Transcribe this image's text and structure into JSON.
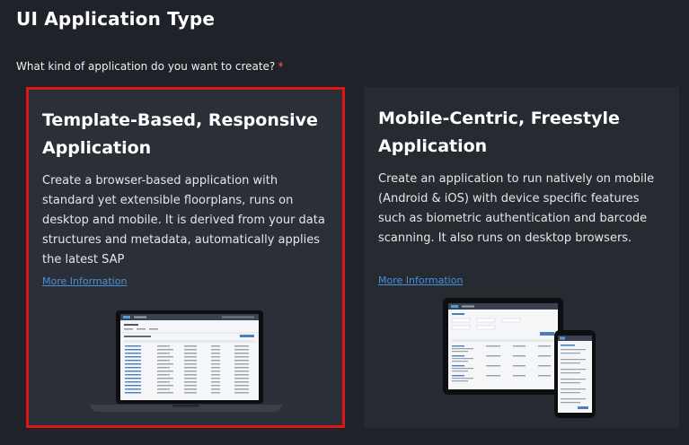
{
  "page": {
    "title": "UI Application Type",
    "question": "What kind of application do you want to create?",
    "required_marker": "*"
  },
  "cards": [
    {
      "title_line1": "Template-Based, Responsive",
      "title_line2": "Application",
      "description": "Create a browser-based application with standard yet extensible floorplans, runs on desktop and mobile. It is derived from your data structures and metadata, automatically applies the latest SAP",
      "link": "More Information",
      "selected": true
    },
    {
      "title_line1": "Mobile-Centric, Freestyle",
      "title_line2": "Application",
      "description": "Create an application to run natively on mobile (Android & iOS) with device specific features such as biometric authentication and barcode scanning. It also runs on desktop browsers.",
      "link": "More Information",
      "selected": false
    }
  ],
  "colors": {
    "background": "#1f2228",
    "card": "#2a2e36",
    "selected_border": "#e01515",
    "link": "#4b8fd8",
    "required": "#ff5a5a"
  },
  "icons": {
    "left_illustration": "laptop-app-illustration",
    "right_illustration": "tablet-phone-app-illustration"
  }
}
